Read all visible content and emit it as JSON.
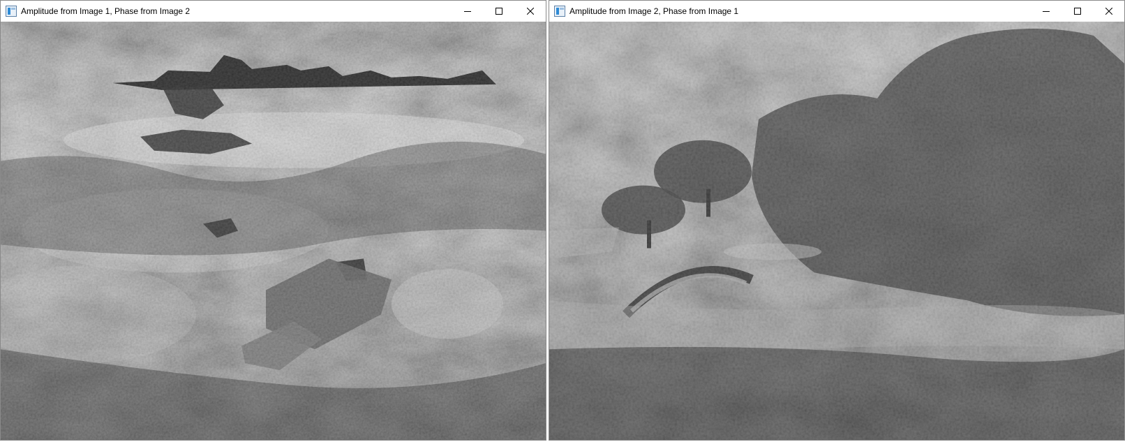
{
  "windows": [
    {
      "title": "Amplitude from Image 1, Phase from Image 2",
      "icons": {
        "app": "app-window-icon",
        "minimize": "minimize-icon",
        "maximize": "maximize-icon",
        "close": "close-icon"
      },
      "image": {
        "description_free": true,
        "tone": "grayscale"
      }
    },
    {
      "title": "Amplitude from Image 2, Phase from Image 1",
      "icons": {
        "app": "app-window-icon",
        "minimize": "minimize-icon",
        "maximize": "maximize-icon",
        "close": "close-icon"
      },
      "image": {
        "tone": "grayscale"
      }
    }
  ],
  "colors": {
    "titlebar_bg": "#ffffff",
    "window_border": "#8a8a8a",
    "glyph": "#000000"
  }
}
